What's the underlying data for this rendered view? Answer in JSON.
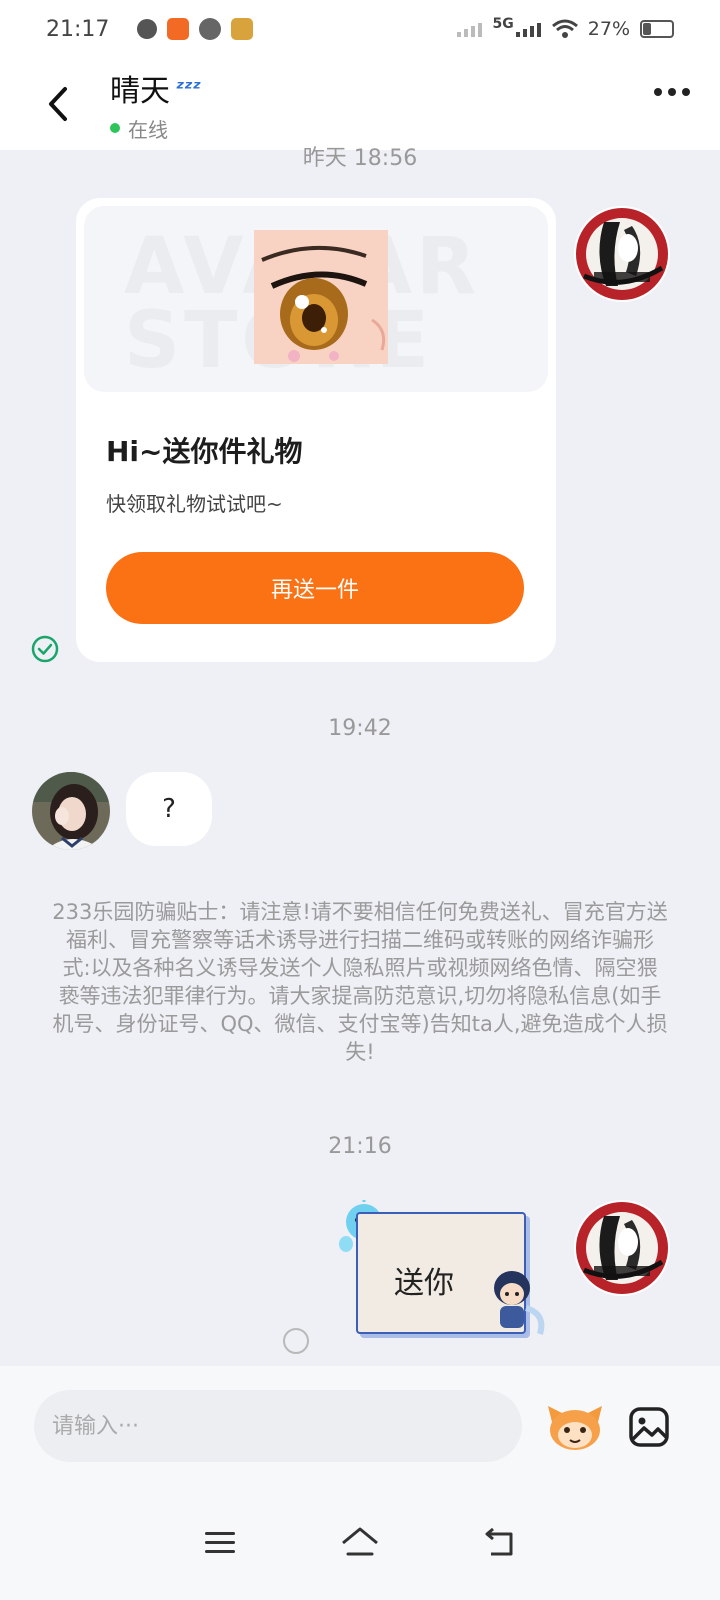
{
  "status_bar": {
    "time": "21:17",
    "network": "5G",
    "battery": "27%",
    "battery_level": 0.27,
    "notification_icons": [
      "chat-bubble-icon",
      "kuaishou-icon",
      "link-icon",
      "game-icon"
    ]
  },
  "header": {
    "name": "晴天",
    "status": "在线",
    "back_icon": "chevron-left-icon",
    "more_icon": "more-dots-icon"
  },
  "timestamps": {
    "first": "昨天 18:56",
    "second": "19:42",
    "third": "21:16"
  },
  "gift_card": {
    "watermark": "AVATAR STORE",
    "title": "Hi~送你件礼物",
    "subtitle": "快领取礼物试试吧~",
    "button": "再送一件"
  },
  "messages": {
    "question": "?",
    "sticker_text": "送你"
  },
  "notice": "233乐园防骗贴士：请注意!请不要相信任何免费送礼、冒充官方送福利、冒充警察等话术诱导进行扫描二维码或转账的网络诈骗形式:以及各种名义诱导发送个人隐私照片或视频网络色情、隔空猥亵等违法犯罪律行为。请大家提高防范意识,切勿将隐私信息(如手机号、身份证号、QQ、微信、支付宝等)告知ta人,避免造成个人损失!",
  "input": {
    "placeholder": "请输入···"
  },
  "colors": {
    "accent_orange": "#fb7214",
    "online_green": "#2ec45a",
    "check_green": "#1aa56a",
    "zzz_blue": "#2b6fd6"
  }
}
